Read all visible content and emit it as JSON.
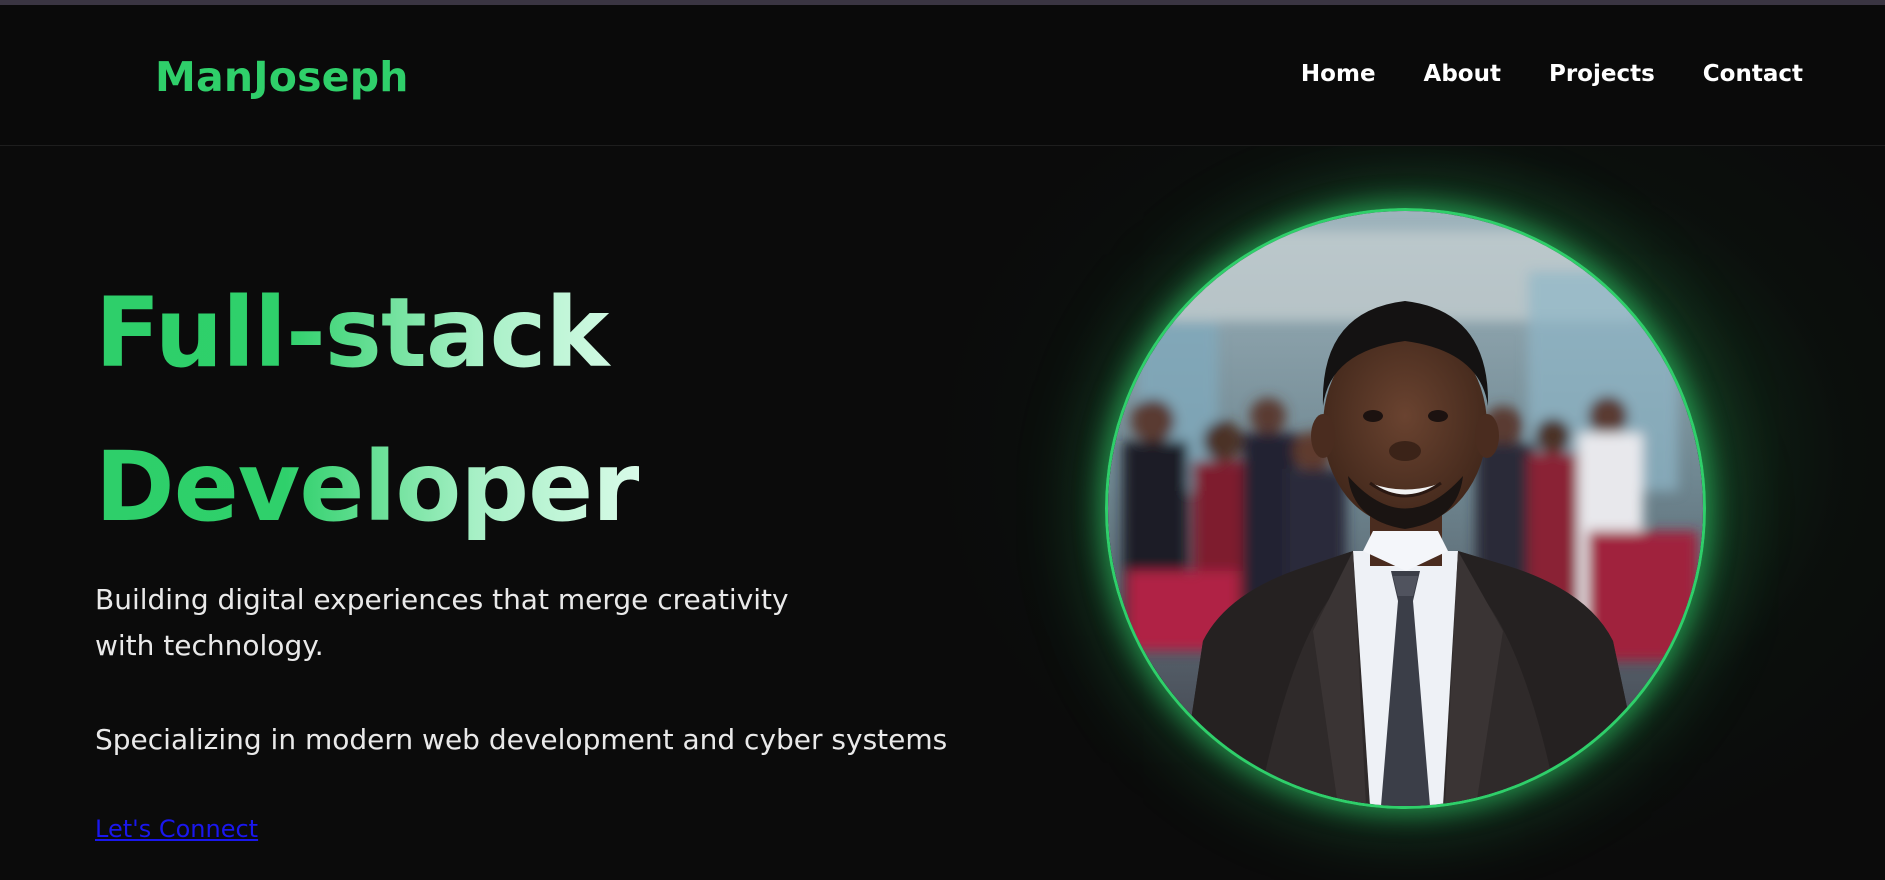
{
  "brand": "ManJoseph",
  "nav": {
    "items": [
      {
        "label": "Home"
      },
      {
        "label": "About"
      },
      {
        "label": "Projects"
      },
      {
        "label": "Contact"
      }
    ]
  },
  "hero": {
    "title_line1": "Full-stack",
    "title_line2": "Developer",
    "description": "Building digital experiences that merge creativity with technology.",
    "specialization": "Specializing in modern web development and cyber systems",
    "cta_label": "Let's Connect"
  },
  "colors": {
    "accent": "#2fcf6a",
    "background": "#0b0b0b",
    "link": "#1a17ee"
  }
}
